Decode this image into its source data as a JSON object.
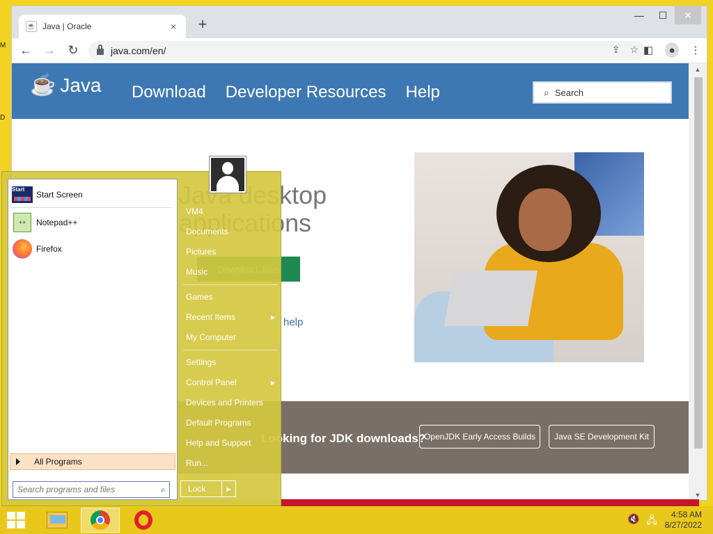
{
  "desktop": {
    "edge_label_1": "M",
    "edge_label_2": "D"
  },
  "browser": {
    "tab_title": "Java | Oracle",
    "tab_close": "×",
    "new_tab": "+",
    "window_controls": {
      "minimize": "—",
      "maximize": "☐",
      "close": "✕"
    },
    "url": "java.com/en/"
  },
  "java_site": {
    "logo_text": "Java",
    "nav": [
      "Download",
      "Developer Resources",
      "Help"
    ],
    "search_placeholder": "Search",
    "hero_title": "Java desktop applications",
    "hero_button": "Download Java",
    "hero_help": "help",
    "jdk_question": "Looking for JDK downloads?",
    "jdk_buttons": [
      "OpenJDK Early Access Builds",
      "Java SE Development Kit"
    ]
  },
  "start_menu": {
    "pinned": [
      "Start Screen",
      "Notepad++",
      "Firefox"
    ],
    "all_programs": "All Programs",
    "search_placeholder": "Search programs and files",
    "right_links": [
      "VM4",
      "Documents",
      "Pictures",
      "Music",
      "Games",
      "Recent Items",
      "My Computer",
      "Settings",
      "Control Panel",
      "Devices and Printers",
      "Default Programs",
      "Help and Support",
      "Run..."
    ],
    "lock_label": "Lock"
  },
  "taskbar": {
    "time": "4:58 AM",
    "date": "8/27/2022"
  },
  "colors": {
    "java_header": "#3d78b4",
    "jdk_band": "#7a6f66",
    "start_menu_bg": "#d4c840",
    "taskbar": "#e9c81c"
  }
}
